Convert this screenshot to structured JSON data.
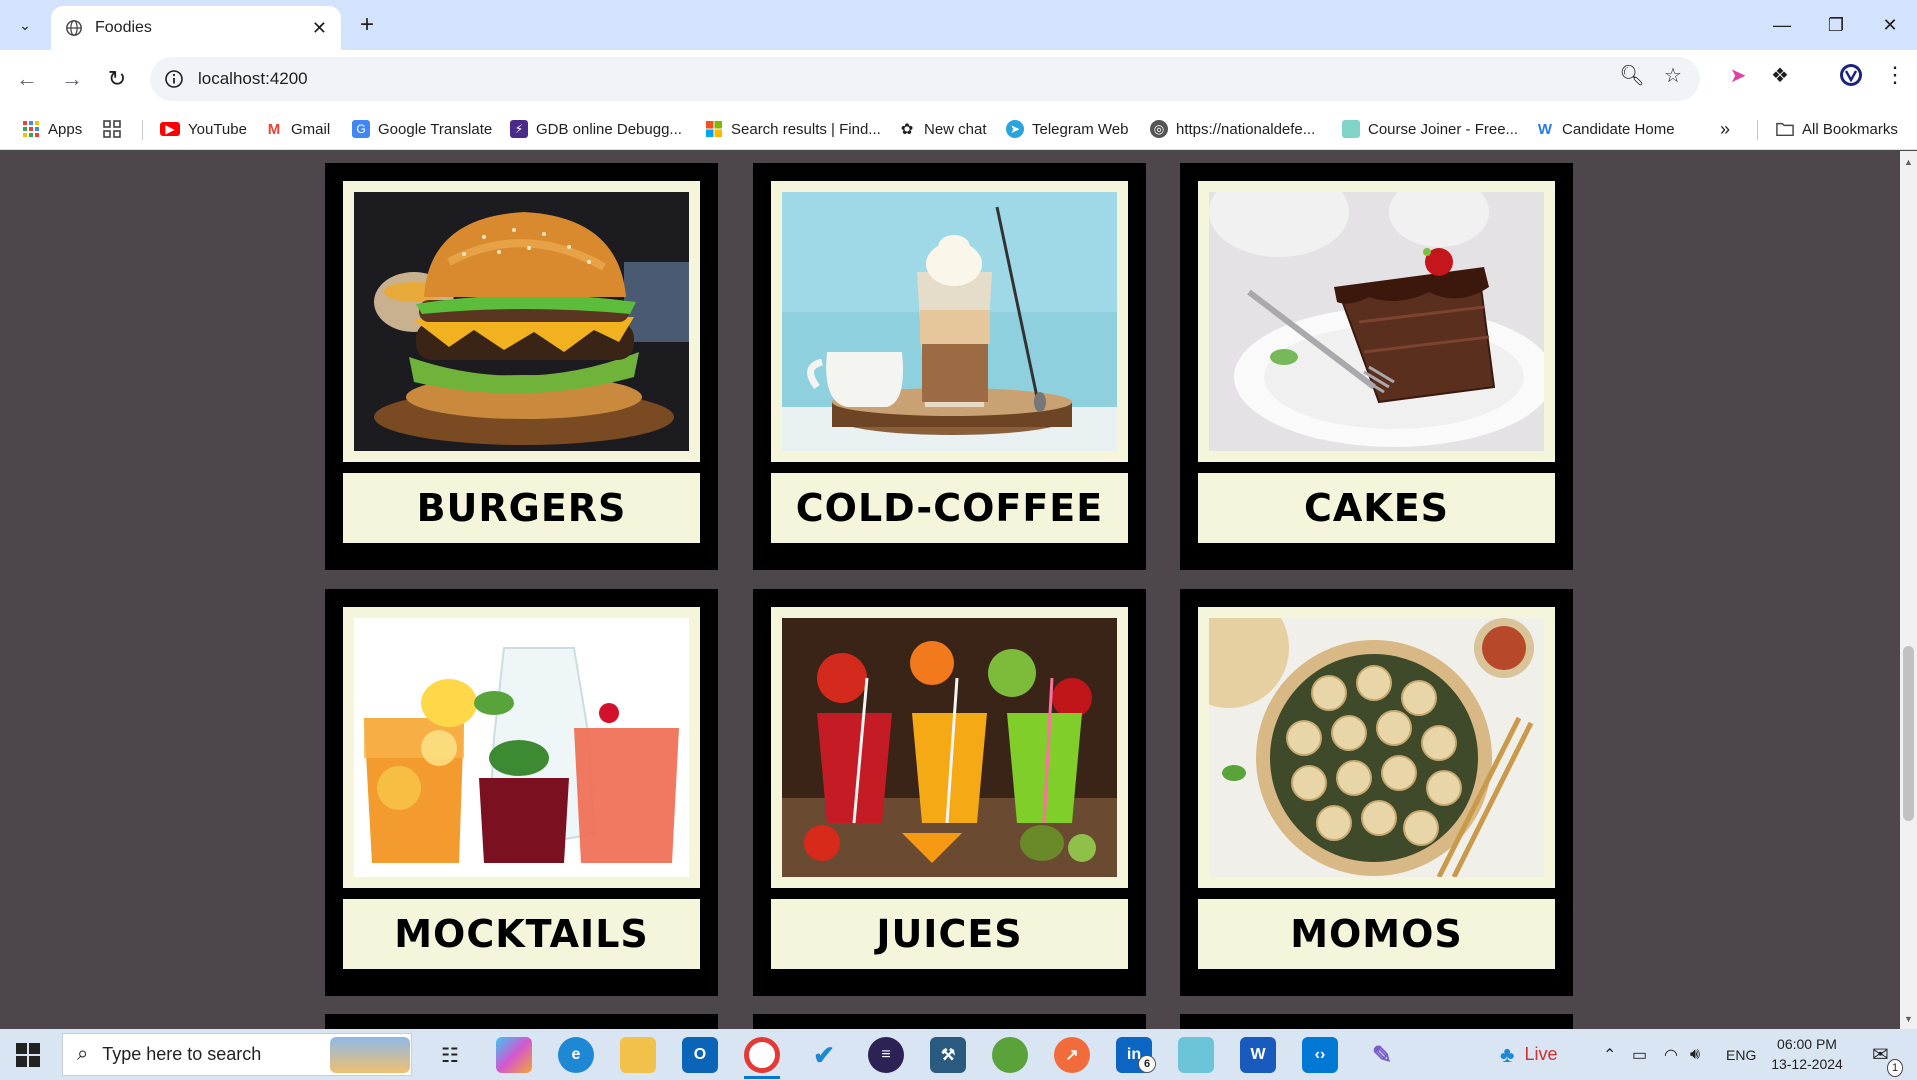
{
  "browser": {
    "tab_title": "Foodies",
    "url": "localhost:4200",
    "bookmarks": [
      {
        "label": "Apps",
        "icon": "apps-grid-icon"
      },
      {
        "label": "YouTube",
        "icon": "youtube-icon"
      },
      {
        "label": "Gmail",
        "icon": "gmail-icon"
      },
      {
        "label": "Google Translate",
        "icon": "translate-icon"
      },
      {
        "label": "GDB online Debugg...",
        "icon": "gdb-icon"
      },
      {
        "label": "Search results | Find...",
        "icon": "microsoft-icon"
      },
      {
        "label": "New chat",
        "icon": "chatgpt-icon"
      },
      {
        "label": "Telegram Web",
        "icon": "telegram-icon"
      },
      {
        "label": "https://nationaldefe...",
        "icon": "globe-icon"
      },
      {
        "label": "Course Joiner - Free...",
        "icon": "course-icon"
      },
      {
        "label": "Candidate Home",
        "icon": "candidate-icon"
      }
    ],
    "all_bookmarks_label": "All Bookmarks"
  },
  "menu": {
    "items": [
      {
        "label": "BURGERS",
        "image": "burger"
      },
      {
        "label": "COLD-COFFEE",
        "image": "cold-coffee"
      },
      {
        "label": "CAKES",
        "image": "cake"
      },
      {
        "label": "MOCKTAILS",
        "image": "mocktails"
      },
      {
        "label": "JUICES",
        "image": "juices"
      },
      {
        "label": "MOMOS",
        "image": "momos"
      }
    ]
  },
  "taskbar": {
    "search_placeholder": "Type here to search",
    "live_label": "Live",
    "language": "ENG",
    "time": "06:00 PM",
    "date": "13-12-2024",
    "linkedin_badge": "6",
    "notification_count": "1"
  },
  "colors": {
    "page_bg": "#4d474c",
    "card_bg": "#000000",
    "card_frame": "#f5f5dc"
  }
}
